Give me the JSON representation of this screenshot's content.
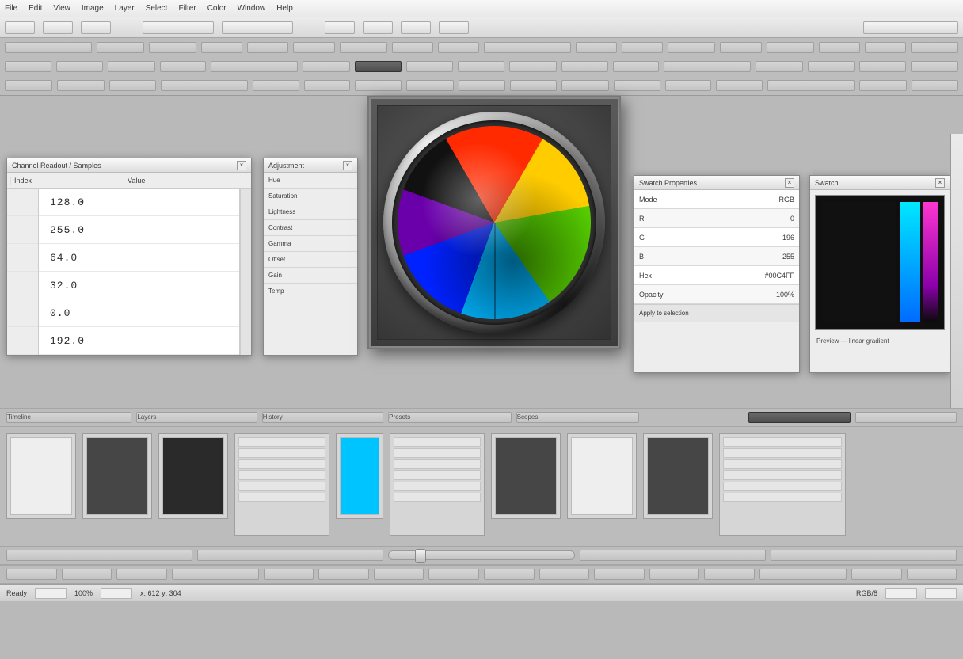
{
  "menubar": [
    "File",
    "Edit",
    "View",
    "Image",
    "Layer",
    "Select",
    "Filter",
    "Color",
    "Window",
    "Help"
  ],
  "leftPanel": {
    "title": "Channel Readout / Samples",
    "col1": "Index",
    "col2": "Value",
    "values": [
      "128.0",
      "255.0",
      "64.0",
      "32.0",
      "0.0",
      "192.0"
    ]
  },
  "midPanel": {
    "title": "Adjustment",
    "rows": [
      "Hue",
      "Saturation",
      "Lightness",
      "Contrast",
      "Gamma",
      "Offset",
      "Gain",
      "Temp"
    ]
  },
  "wheel": {
    "segments": [
      {
        "name": "red",
        "hex": "#ff2a00"
      },
      {
        "name": "yellow",
        "hex": "#ffcc00"
      },
      {
        "name": "green",
        "hex": "#55cc00"
      },
      {
        "name": "cyan",
        "hex": "#00b5ff"
      },
      {
        "name": "blue",
        "hex": "#0022ff"
      },
      {
        "name": "violet",
        "hex": "#6a00aa"
      },
      {
        "name": "black",
        "hex": "#111111"
      }
    ]
  },
  "propPanel": {
    "title": "Swatch Properties",
    "rows": [
      {
        "k": "Mode",
        "v": "RGB"
      },
      {
        "k": "R",
        "v": "0"
      },
      {
        "k": "G",
        "v": "196"
      },
      {
        "k": "B",
        "v": "255"
      },
      {
        "k": "Hex",
        "v": "#00C4FF"
      },
      {
        "k": "Opacity",
        "v": "100%"
      }
    ],
    "footer": "Apply to selection"
  },
  "swatchPanel": {
    "title": "Swatch",
    "footer": "Preview — linear gradient"
  },
  "lowerTabs": [
    "Timeline",
    "Layers",
    "History",
    "Presets",
    "Scopes"
  ],
  "status": {
    "left": "Ready",
    "zoom": "100%",
    "pos": "x: 612  y: 304",
    "mode": "RGB/8"
  }
}
